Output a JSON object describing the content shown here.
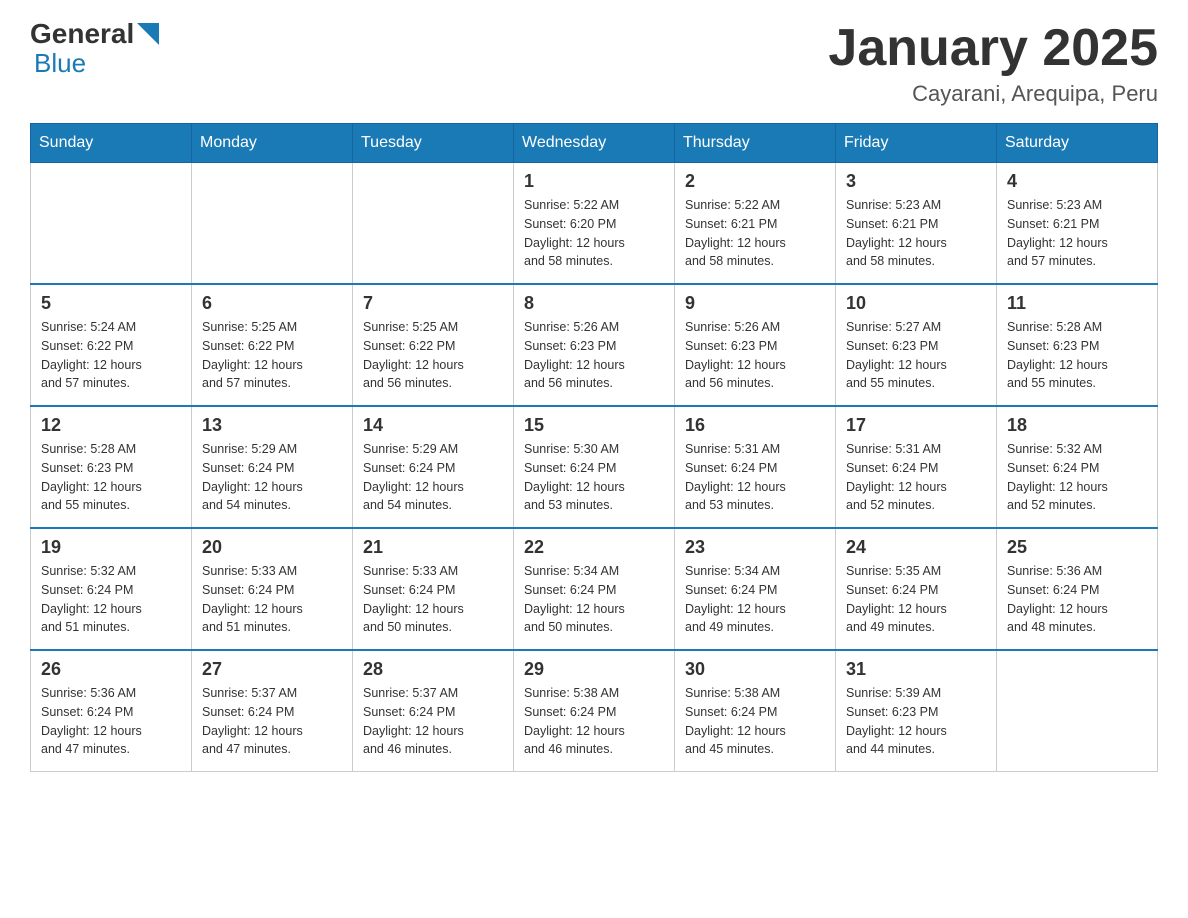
{
  "header": {
    "logo": {
      "text_general": "General",
      "text_blue": "Blue"
    },
    "title": "January 2025",
    "location": "Cayarani, Arequipa, Peru"
  },
  "days_of_week": [
    "Sunday",
    "Monday",
    "Tuesday",
    "Wednesday",
    "Thursday",
    "Friday",
    "Saturday"
  ],
  "weeks": [
    [
      {
        "day": "",
        "info": ""
      },
      {
        "day": "",
        "info": ""
      },
      {
        "day": "",
        "info": ""
      },
      {
        "day": "1",
        "info": "Sunrise: 5:22 AM\nSunset: 6:20 PM\nDaylight: 12 hours\nand 58 minutes."
      },
      {
        "day": "2",
        "info": "Sunrise: 5:22 AM\nSunset: 6:21 PM\nDaylight: 12 hours\nand 58 minutes."
      },
      {
        "day": "3",
        "info": "Sunrise: 5:23 AM\nSunset: 6:21 PM\nDaylight: 12 hours\nand 58 minutes."
      },
      {
        "day": "4",
        "info": "Sunrise: 5:23 AM\nSunset: 6:21 PM\nDaylight: 12 hours\nand 57 minutes."
      }
    ],
    [
      {
        "day": "5",
        "info": "Sunrise: 5:24 AM\nSunset: 6:22 PM\nDaylight: 12 hours\nand 57 minutes."
      },
      {
        "day": "6",
        "info": "Sunrise: 5:25 AM\nSunset: 6:22 PM\nDaylight: 12 hours\nand 57 minutes."
      },
      {
        "day": "7",
        "info": "Sunrise: 5:25 AM\nSunset: 6:22 PM\nDaylight: 12 hours\nand 56 minutes."
      },
      {
        "day": "8",
        "info": "Sunrise: 5:26 AM\nSunset: 6:23 PM\nDaylight: 12 hours\nand 56 minutes."
      },
      {
        "day": "9",
        "info": "Sunrise: 5:26 AM\nSunset: 6:23 PM\nDaylight: 12 hours\nand 56 minutes."
      },
      {
        "day": "10",
        "info": "Sunrise: 5:27 AM\nSunset: 6:23 PM\nDaylight: 12 hours\nand 55 minutes."
      },
      {
        "day": "11",
        "info": "Sunrise: 5:28 AM\nSunset: 6:23 PM\nDaylight: 12 hours\nand 55 minutes."
      }
    ],
    [
      {
        "day": "12",
        "info": "Sunrise: 5:28 AM\nSunset: 6:23 PM\nDaylight: 12 hours\nand 55 minutes."
      },
      {
        "day": "13",
        "info": "Sunrise: 5:29 AM\nSunset: 6:24 PM\nDaylight: 12 hours\nand 54 minutes."
      },
      {
        "day": "14",
        "info": "Sunrise: 5:29 AM\nSunset: 6:24 PM\nDaylight: 12 hours\nand 54 minutes."
      },
      {
        "day": "15",
        "info": "Sunrise: 5:30 AM\nSunset: 6:24 PM\nDaylight: 12 hours\nand 53 minutes."
      },
      {
        "day": "16",
        "info": "Sunrise: 5:31 AM\nSunset: 6:24 PM\nDaylight: 12 hours\nand 53 minutes."
      },
      {
        "day": "17",
        "info": "Sunrise: 5:31 AM\nSunset: 6:24 PM\nDaylight: 12 hours\nand 52 minutes."
      },
      {
        "day": "18",
        "info": "Sunrise: 5:32 AM\nSunset: 6:24 PM\nDaylight: 12 hours\nand 52 minutes."
      }
    ],
    [
      {
        "day": "19",
        "info": "Sunrise: 5:32 AM\nSunset: 6:24 PM\nDaylight: 12 hours\nand 51 minutes."
      },
      {
        "day": "20",
        "info": "Sunrise: 5:33 AM\nSunset: 6:24 PM\nDaylight: 12 hours\nand 51 minutes."
      },
      {
        "day": "21",
        "info": "Sunrise: 5:33 AM\nSunset: 6:24 PM\nDaylight: 12 hours\nand 50 minutes."
      },
      {
        "day": "22",
        "info": "Sunrise: 5:34 AM\nSunset: 6:24 PM\nDaylight: 12 hours\nand 50 minutes."
      },
      {
        "day": "23",
        "info": "Sunrise: 5:34 AM\nSunset: 6:24 PM\nDaylight: 12 hours\nand 49 minutes."
      },
      {
        "day": "24",
        "info": "Sunrise: 5:35 AM\nSunset: 6:24 PM\nDaylight: 12 hours\nand 49 minutes."
      },
      {
        "day": "25",
        "info": "Sunrise: 5:36 AM\nSunset: 6:24 PM\nDaylight: 12 hours\nand 48 minutes."
      }
    ],
    [
      {
        "day": "26",
        "info": "Sunrise: 5:36 AM\nSunset: 6:24 PM\nDaylight: 12 hours\nand 47 minutes."
      },
      {
        "day": "27",
        "info": "Sunrise: 5:37 AM\nSunset: 6:24 PM\nDaylight: 12 hours\nand 47 minutes."
      },
      {
        "day": "28",
        "info": "Sunrise: 5:37 AM\nSunset: 6:24 PM\nDaylight: 12 hours\nand 46 minutes."
      },
      {
        "day": "29",
        "info": "Sunrise: 5:38 AM\nSunset: 6:24 PM\nDaylight: 12 hours\nand 46 minutes."
      },
      {
        "day": "30",
        "info": "Sunrise: 5:38 AM\nSunset: 6:24 PM\nDaylight: 12 hours\nand 45 minutes."
      },
      {
        "day": "31",
        "info": "Sunrise: 5:39 AM\nSunset: 6:23 PM\nDaylight: 12 hours\nand 44 minutes."
      },
      {
        "day": "",
        "info": ""
      }
    ]
  ]
}
